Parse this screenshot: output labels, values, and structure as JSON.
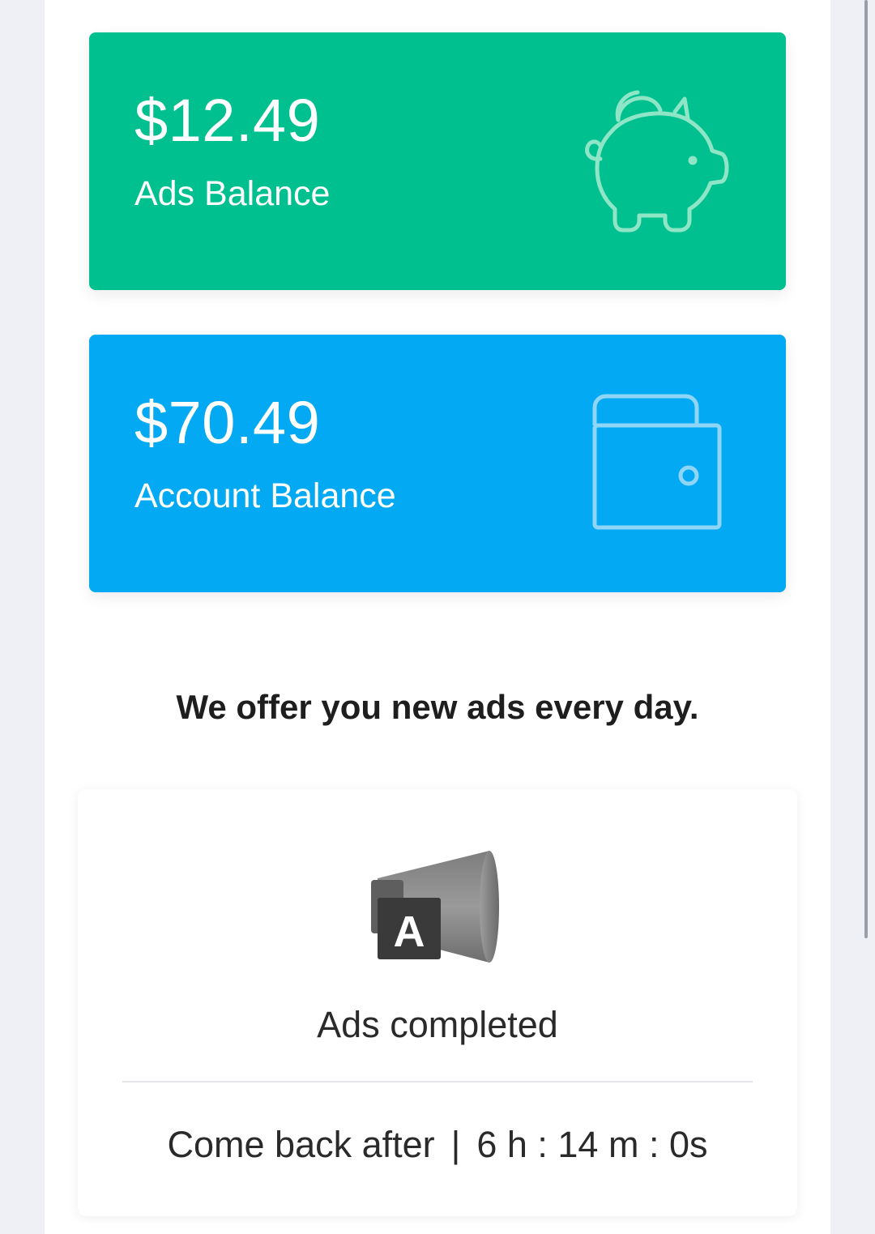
{
  "ads_card": {
    "amount": "$12.49",
    "label": "Ads Balance",
    "icon": "piggy-bank-icon",
    "color": "#00c08f"
  },
  "account_card": {
    "amount": "$70.49",
    "label": "Account Balance",
    "icon": "wallet-icon",
    "color": "#03a9f2"
  },
  "tagline": "We offer you new ads every day.",
  "status": {
    "icon": "ads-megaphone-icon",
    "icon_letter": "A",
    "title": "Ads completed",
    "come_back_label": "Come back after",
    "separator": "|",
    "countdown": "6 h : 14 m : 0s"
  }
}
